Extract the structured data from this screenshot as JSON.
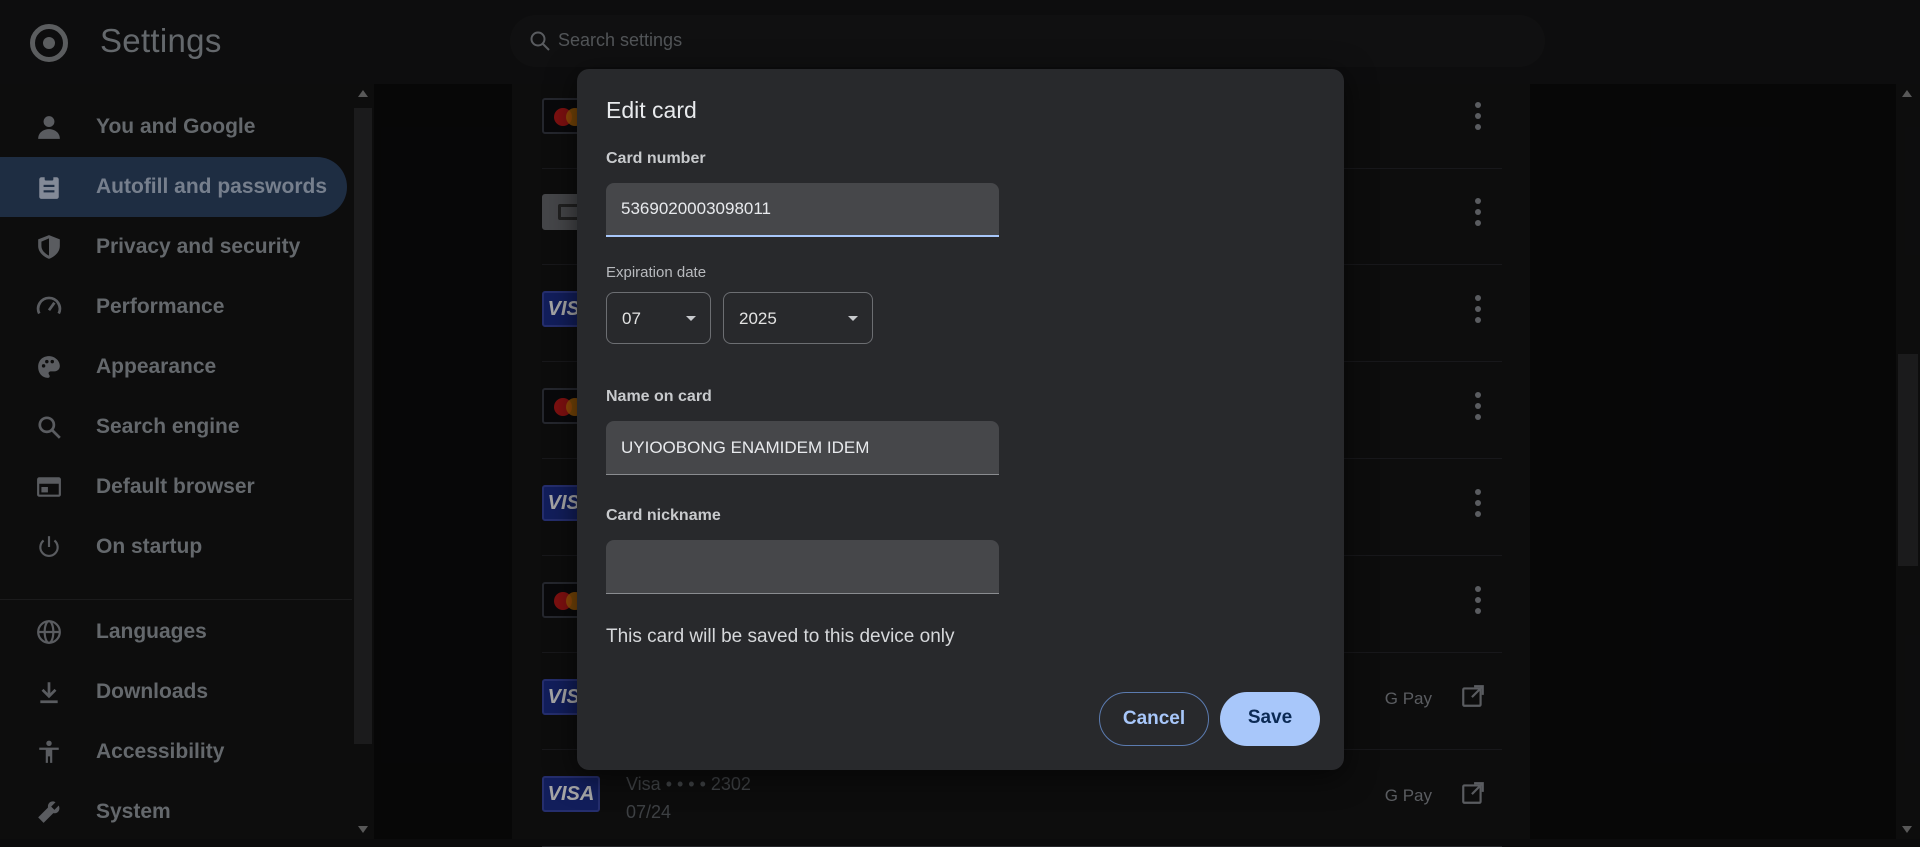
{
  "app": {
    "title": "Settings"
  },
  "search": {
    "placeholder": "Search settings"
  },
  "sidebar": {
    "items": [
      {
        "label": "You and Google",
        "icon": "person-icon"
      },
      {
        "label": "Autofill and passwords",
        "icon": "clipboard-icon",
        "active": true
      },
      {
        "label": "Privacy and security",
        "icon": "shield-icon"
      },
      {
        "label": "Performance",
        "icon": "speedometer-icon"
      },
      {
        "label": "Appearance",
        "icon": "palette-icon"
      },
      {
        "label": "Search engine",
        "icon": "search-icon"
      },
      {
        "label": "Default browser",
        "icon": "browser-icon"
      },
      {
        "label": "On startup",
        "icon": "power-icon"
      },
      {
        "label": "Languages",
        "icon": "globe-icon"
      },
      {
        "label": "Downloads",
        "icon": "download-icon"
      },
      {
        "label": "Accessibility",
        "icon": "accessibility-icon"
      },
      {
        "label": "System",
        "icon": "wrench-icon"
      }
    ]
  },
  "cards_list": {
    "rows": [
      {
        "brand": "mastercard"
      },
      {
        "brand": "generic"
      },
      {
        "brand": "visa",
        "brand_text": "VISA"
      },
      {
        "brand": "mastercard"
      },
      {
        "brand": "visa",
        "brand_text": "VISA"
      },
      {
        "brand": "mastercard"
      },
      {
        "brand": "visa",
        "brand_text": "VISA",
        "gpay": "G Pay"
      },
      {
        "brand": "visa",
        "brand_text": "VISA",
        "gpay": "G Pay",
        "name": "Visa • • • • 2302",
        "exp": "07/24"
      }
    ]
  },
  "dialog": {
    "title": "Edit card",
    "card_number_label": "Card number",
    "card_number_value": "5369020003098011",
    "expiration_label": "Expiration date",
    "exp_month": "07",
    "exp_year": "2025",
    "name_label": "Name on card",
    "name_value": "UYIOOBONG ENAMIDEM IDEM",
    "nickname_label": "Card nickname",
    "nickname_value": "",
    "note": "This card will be saved to this device only",
    "cancel_label": "Cancel",
    "save_label": "Save"
  },
  "colors": {
    "accent": "#a8c7fa",
    "active_nav_bg": "#2f4566",
    "dialog_bg": "#28292c"
  }
}
